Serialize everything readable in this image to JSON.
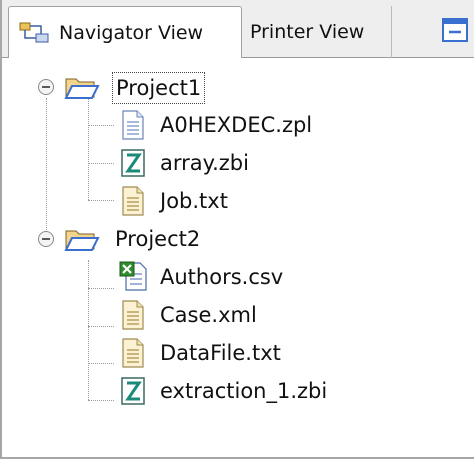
{
  "tabs": {
    "navigator_label": "Navigator View",
    "printer_label": "Printer View"
  },
  "tree": {
    "projects": [
      {
        "name": "Project1",
        "files": [
          {
            "name": "A0HEXDEC.zpl",
            "icon": "document-icon"
          },
          {
            "name": "array.zbi",
            "icon": "zbi-file-icon"
          },
          {
            "name": "Job.txt",
            "icon": "text-file-icon"
          }
        ]
      },
      {
        "name": "Project2",
        "files": [
          {
            "name": "Authors.csv",
            "icon": "csv-file-icon"
          },
          {
            "name": "Case.xml",
            "icon": "text-file-icon"
          },
          {
            "name": "DataFile.txt",
            "icon": "text-file-icon"
          },
          {
            "name": "extraction_1.zbi",
            "icon": "zbi-file-icon"
          }
        ]
      }
    ]
  },
  "colors": {
    "folder": "#f4d27a",
    "folder_outline": "#3a6fd0",
    "zbi_z": "#1a8a7a",
    "csv_green": "#2e8b2e"
  }
}
